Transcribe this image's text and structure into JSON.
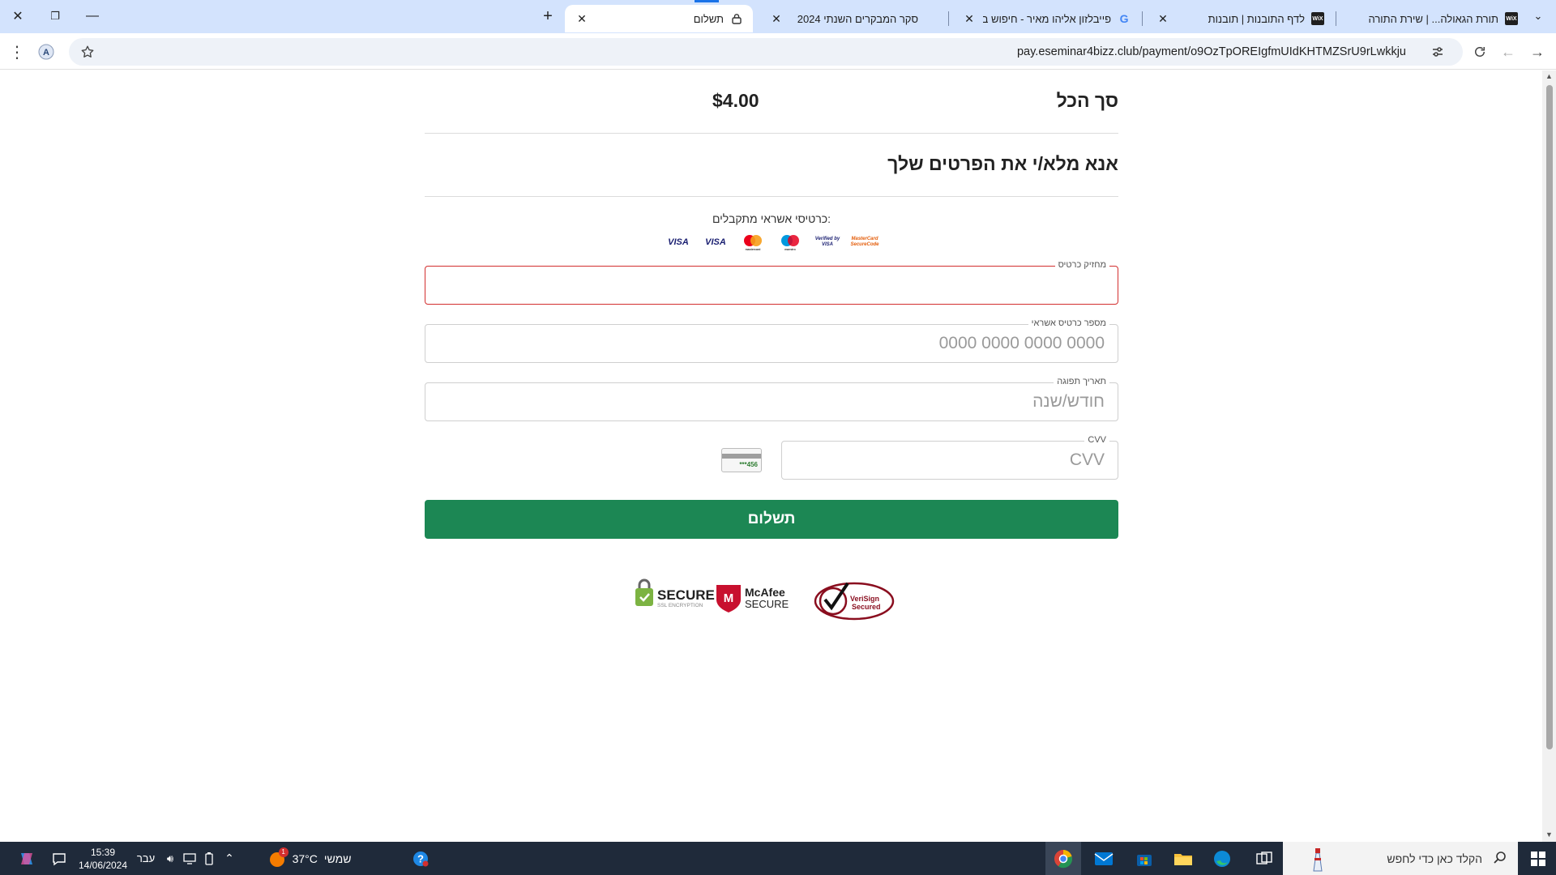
{
  "browser": {
    "tabs": [
      {
        "title": "תורת הגאולה... | שירת התורה",
        "favicon": "wix-icon"
      },
      {
        "title": "לדף התובנות | תובנות",
        "favicon": "wix-icon"
      },
      {
        "title": "פייבלזון אליהו מאיר - חיפוש ב-G",
        "favicon": "google-icon"
      },
      {
        "title": "סקר המבקרים השנתי 2024",
        "favicon": ""
      },
      {
        "title": "תשלום",
        "favicon": "lock-icon",
        "active": true
      }
    ],
    "url": "pay.eseminar4bizz.club/payment/o9OzTpOREIgfmUIdKHTMZSrU9rLwkkju"
  },
  "payment": {
    "total_label": "סך הכל",
    "total_amount": "$4.00",
    "heading": "אנא מלא/י את הפרטים שלך",
    "accepted_cards_label": ":כרטיסי אשראי מתקבלים",
    "cards": [
      "VISA",
      "VISA",
      "mastercard",
      "maestro",
      "Verified by VISA",
      "MasterCard SecureCode"
    ],
    "fields": {
      "cardholder": {
        "label": "מחזיק כרטיס",
        "placeholder": "",
        "value": ""
      },
      "card_number": {
        "label": "מספר כרטיס אשראי",
        "placeholder": "0000 0000 0000 0000",
        "value": ""
      },
      "expiry": {
        "label": "תאריך תפוגה",
        "placeholder": "חודש/שנה",
        "value": ""
      },
      "cvv": {
        "label": "CVV",
        "placeholder": "CVV",
        "value": ""
      }
    },
    "cvv_hint": "***456",
    "pay_button": "תשלום",
    "badges": {
      "secure_title": "SECURE",
      "secure_sub": "SSL ENCRYPTION",
      "mcafee_title": "McAfee",
      "mcafee_sub": "SECURE",
      "verisign_line1": "VeriSign",
      "verisign_line2": "Secured"
    }
  },
  "taskbar": {
    "search_placeholder": "הקלד כאן כדי לחפש",
    "weather_label": "שמשי",
    "temperature": "37°C",
    "language": "עבר",
    "time": "15:39",
    "date": "14/06/2024",
    "notification_count": "1"
  },
  "colors": {
    "pay_button": "#1c8754",
    "error_border": "#d32f2f",
    "tab_strip": "#d3e3fd"
  }
}
